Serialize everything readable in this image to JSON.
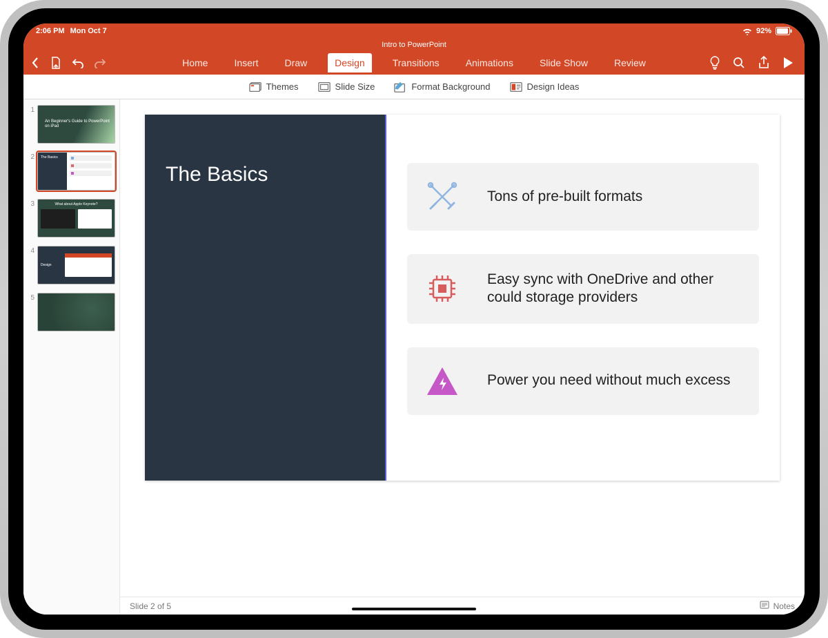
{
  "status": {
    "time": "2:06 PM",
    "date": "Mon Oct 7",
    "battery": "92%"
  },
  "document": {
    "title": "Intro to PowerPoint"
  },
  "tabs": {
    "home": "Home",
    "insert": "Insert",
    "draw": "Draw",
    "design": "Design",
    "transitions": "Transitions",
    "animations": "Animations",
    "slideshow": "Slide Show",
    "review": "Review"
  },
  "ribbon": {
    "themes": "Themes",
    "slide_size": "Slide Size",
    "format_bg": "Format Background",
    "design_ideas": "Design Ideas"
  },
  "thumbnails": {
    "n1": "1",
    "n2": "2",
    "n3": "3",
    "n4": "4",
    "n5": "5",
    "thumb1_title": "An Beginner's Guide to PowerPoint on iPad",
    "thumb2_title": "The Basics",
    "thumb3_title": "What about Apple Keynote?",
    "thumb4_title": "Design"
  },
  "slide": {
    "title": "The Basics",
    "card1": "Tons of pre-built formats",
    "card2": "Easy sync with OneDrive and other could storage providers",
    "card3": "Power you need without much excess"
  },
  "footer": {
    "left": "Slide 2 of 5",
    "notes": "Notes"
  }
}
